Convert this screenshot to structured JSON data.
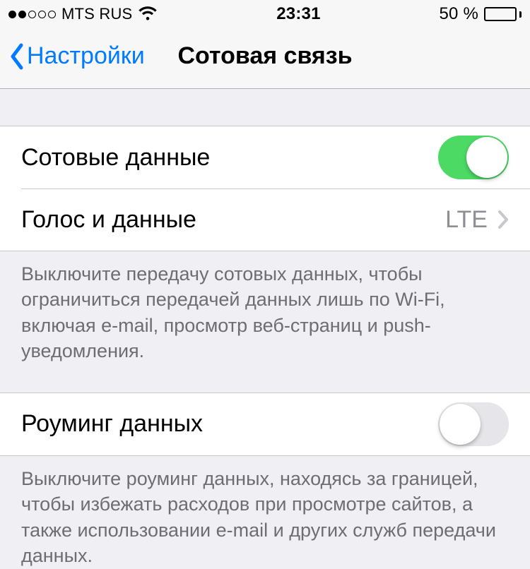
{
  "status": {
    "carrier": "MTS RUS",
    "time": "23:31",
    "battery_pct": "50 %"
  },
  "nav": {
    "back_label": "Настройки",
    "title": "Сотовая связь"
  },
  "group1": {
    "cellular_data_label": "Сотовые данные",
    "cellular_data_on": true,
    "voice_data_label": "Голос и данные",
    "voice_data_value": "LTE",
    "footer": "Выключите передачу сотовых данных, чтобы ограничиться передачей данных лишь по Wi-Fi, включая e-mail, просмотр веб-страниц и push-уведомления."
  },
  "group2": {
    "roaming_label": "Роуминг данных",
    "roaming_on": false,
    "footer": "Выключите роуминг данных, находясь за границей, чтобы избежать расходов при просмотре сайтов, а также использовании e-mail и других служб передачи данных."
  }
}
